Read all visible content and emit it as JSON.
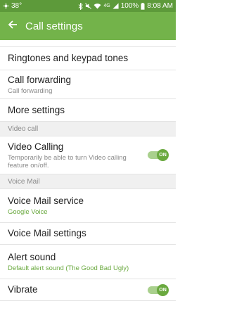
{
  "status_bar": {
    "temperature": "38°",
    "battery": "100%",
    "time": "8:08 AM",
    "network": "4G",
    "color": "#5d9a3a"
  },
  "app_bar": {
    "title": "Call settings",
    "color": "#73b34a"
  },
  "items": {
    "ringtones": {
      "title": "Ringtones and keypad tones"
    },
    "call_forwarding": {
      "title": "Call forwarding",
      "subtitle": "Call forwarding"
    },
    "more_settings": {
      "title": "More settings"
    },
    "video_calling": {
      "title": "Video Calling",
      "subtitle": "Temporarily be able to turn Video calling feature on/off.",
      "toggle": "ON"
    },
    "voice_mail_service": {
      "title": "Voice Mail service",
      "subtitle": "Google Voice"
    },
    "voice_mail_settings": {
      "title": "Voice Mail settings"
    },
    "alert_sound": {
      "title": "Alert sound",
      "subtitle": "Default alert sound (The Good Bad Ugly)"
    },
    "vibrate": {
      "title": "Vibrate",
      "toggle": "ON"
    }
  },
  "sections": {
    "video_call": "Video call",
    "voice_mail": "Voice Mail"
  },
  "accent_color": "#6aa93f"
}
